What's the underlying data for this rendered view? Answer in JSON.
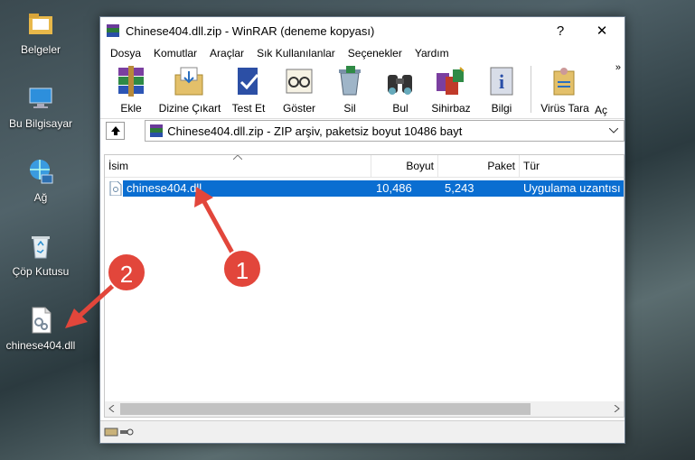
{
  "desktop": {
    "icons": [
      {
        "label": "Belgeler"
      },
      {
        "label": "Bu Bilgisayar"
      },
      {
        "label": "Ağ"
      },
      {
        "label": "Çöp Kutusu"
      },
      {
        "label": "chinese404.dll"
      }
    ]
  },
  "window": {
    "title": "Chinese404.dll.zip - WinRAR (deneme kopyası)",
    "help": "?",
    "close": "✕",
    "menu": [
      "Dosya",
      "Komutlar",
      "Araçlar",
      "Sık Kullanılanlar",
      "Seçenekler",
      "Yardım"
    ],
    "toolbar": [
      "Ekle",
      "Dizine Çıkart",
      "Test Et",
      "Göster",
      "Sil",
      "Bul",
      "Sihirbaz",
      "Bilgi",
      "Virüs Tara",
      "Aç"
    ],
    "more": "»",
    "address": "Chinese404.dll.zip - ZIP arşiv, paketsiz boyut 10486 bayt",
    "columns": {
      "name": "İsim",
      "size": "Boyut",
      "packed": "Paket",
      "type": "Tür"
    },
    "files": [
      {
        "name": "chinese404.dll",
        "size": "10,486",
        "packed": "5,243",
        "type": "Uygulama uzantısı"
      }
    ]
  },
  "annotations": {
    "badge1": "1",
    "badge2": "2"
  },
  "colors": {
    "selection": "#0a6ed1",
    "badge": "#e2463b"
  }
}
